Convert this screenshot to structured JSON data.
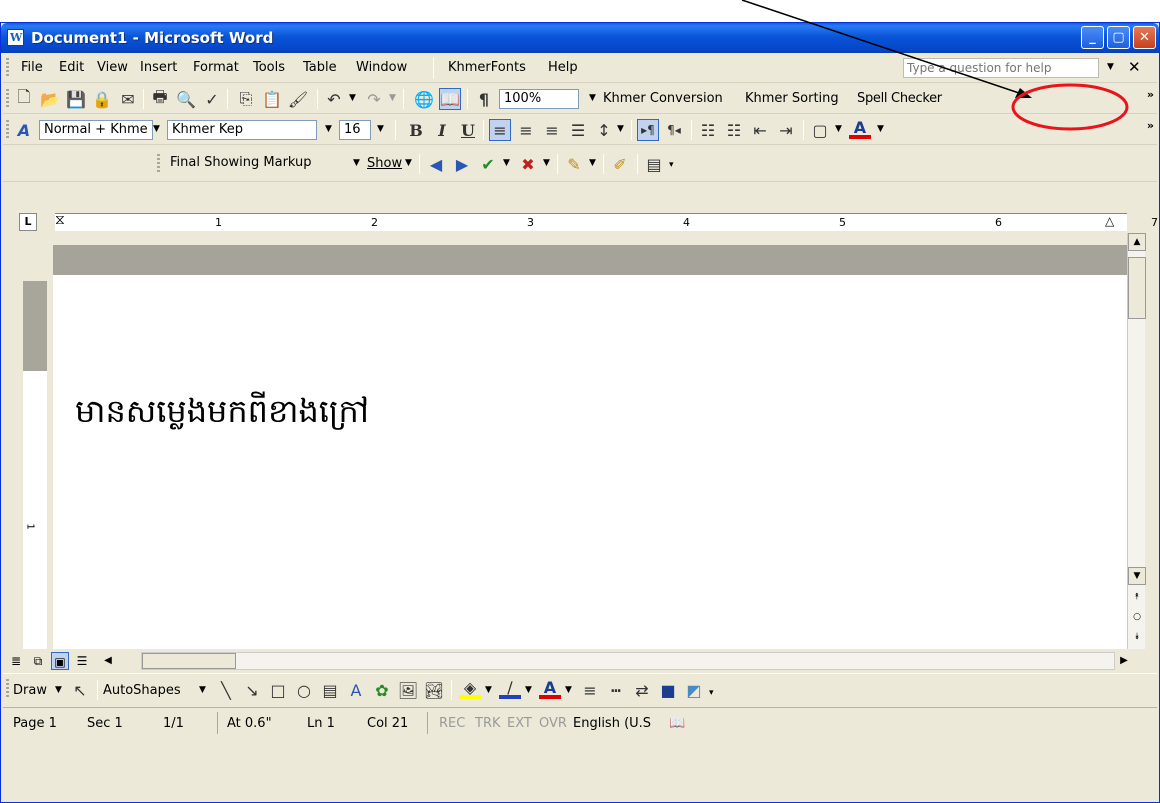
{
  "window": {
    "title": "Document1 - Microsoft Word"
  },
  "menu": {
    "items": [
      "File",
      "Edit",
      "View",
      "Insert",
      "Format",
      "Tools",
      "Table",
      "Window",
      "KhmerFonts",
      "Help"
    ],
    "help_placeholder": "Type a question for help"
  },
  "standard_toolbar": {
    "zoom": "100%",
    "khmer_conversion": "Khmer Conversion",
    "khmer_sorting": "Khmer Sorting",
    "spell_checker": "Spell Checker"
  },
  "format_toolbar": {
    "style": "Normal + Khme",
    "font": "Khmer Kep",
    "size": "16",
    "bold": "B",
    "italic": "I",
    "underline": "U",
    "font_color_glyph": "A"
  },
  "review_toolbar": {
    "display": "Final Showing Markup",
    "show": "Show"
  },
  "ruler": {
    "tab_selector": "L",
    "numbers": [
      "1",
      "2",
      "3",
      "4",
      "5",
      "6",
      "7"
    ]
  },
  "document": {
    "text": "មានសម្លេងមកពីខាងក្រៅ"
  },
  "drawing_toolbar": {
    "draw": "Draw",
    "autoshapes": "AutoShapes"
  },
  "status_bar": {
    "page": "Page 1",
    "sec": "Sec 1",
    "pages": "1/1",
    "at": "At 0.6\"",
    "ln": "Ln 1",
    "col": "Col 21",
    "rec": "REC",
    "trk": "TRK",
    "ext": "EXT",
    "ovr": "OVR",
    "language": "English (U.S"
  },
  "annotation": {
    "highlight_color": "#e8141a",
    "arrow_color": "#000000"
  },
  "colors": {
    "title_bar": "#0a55d8",
    "chrome": "#ece9d8",
    "font_color_underline": "#e00000"
  }
}
